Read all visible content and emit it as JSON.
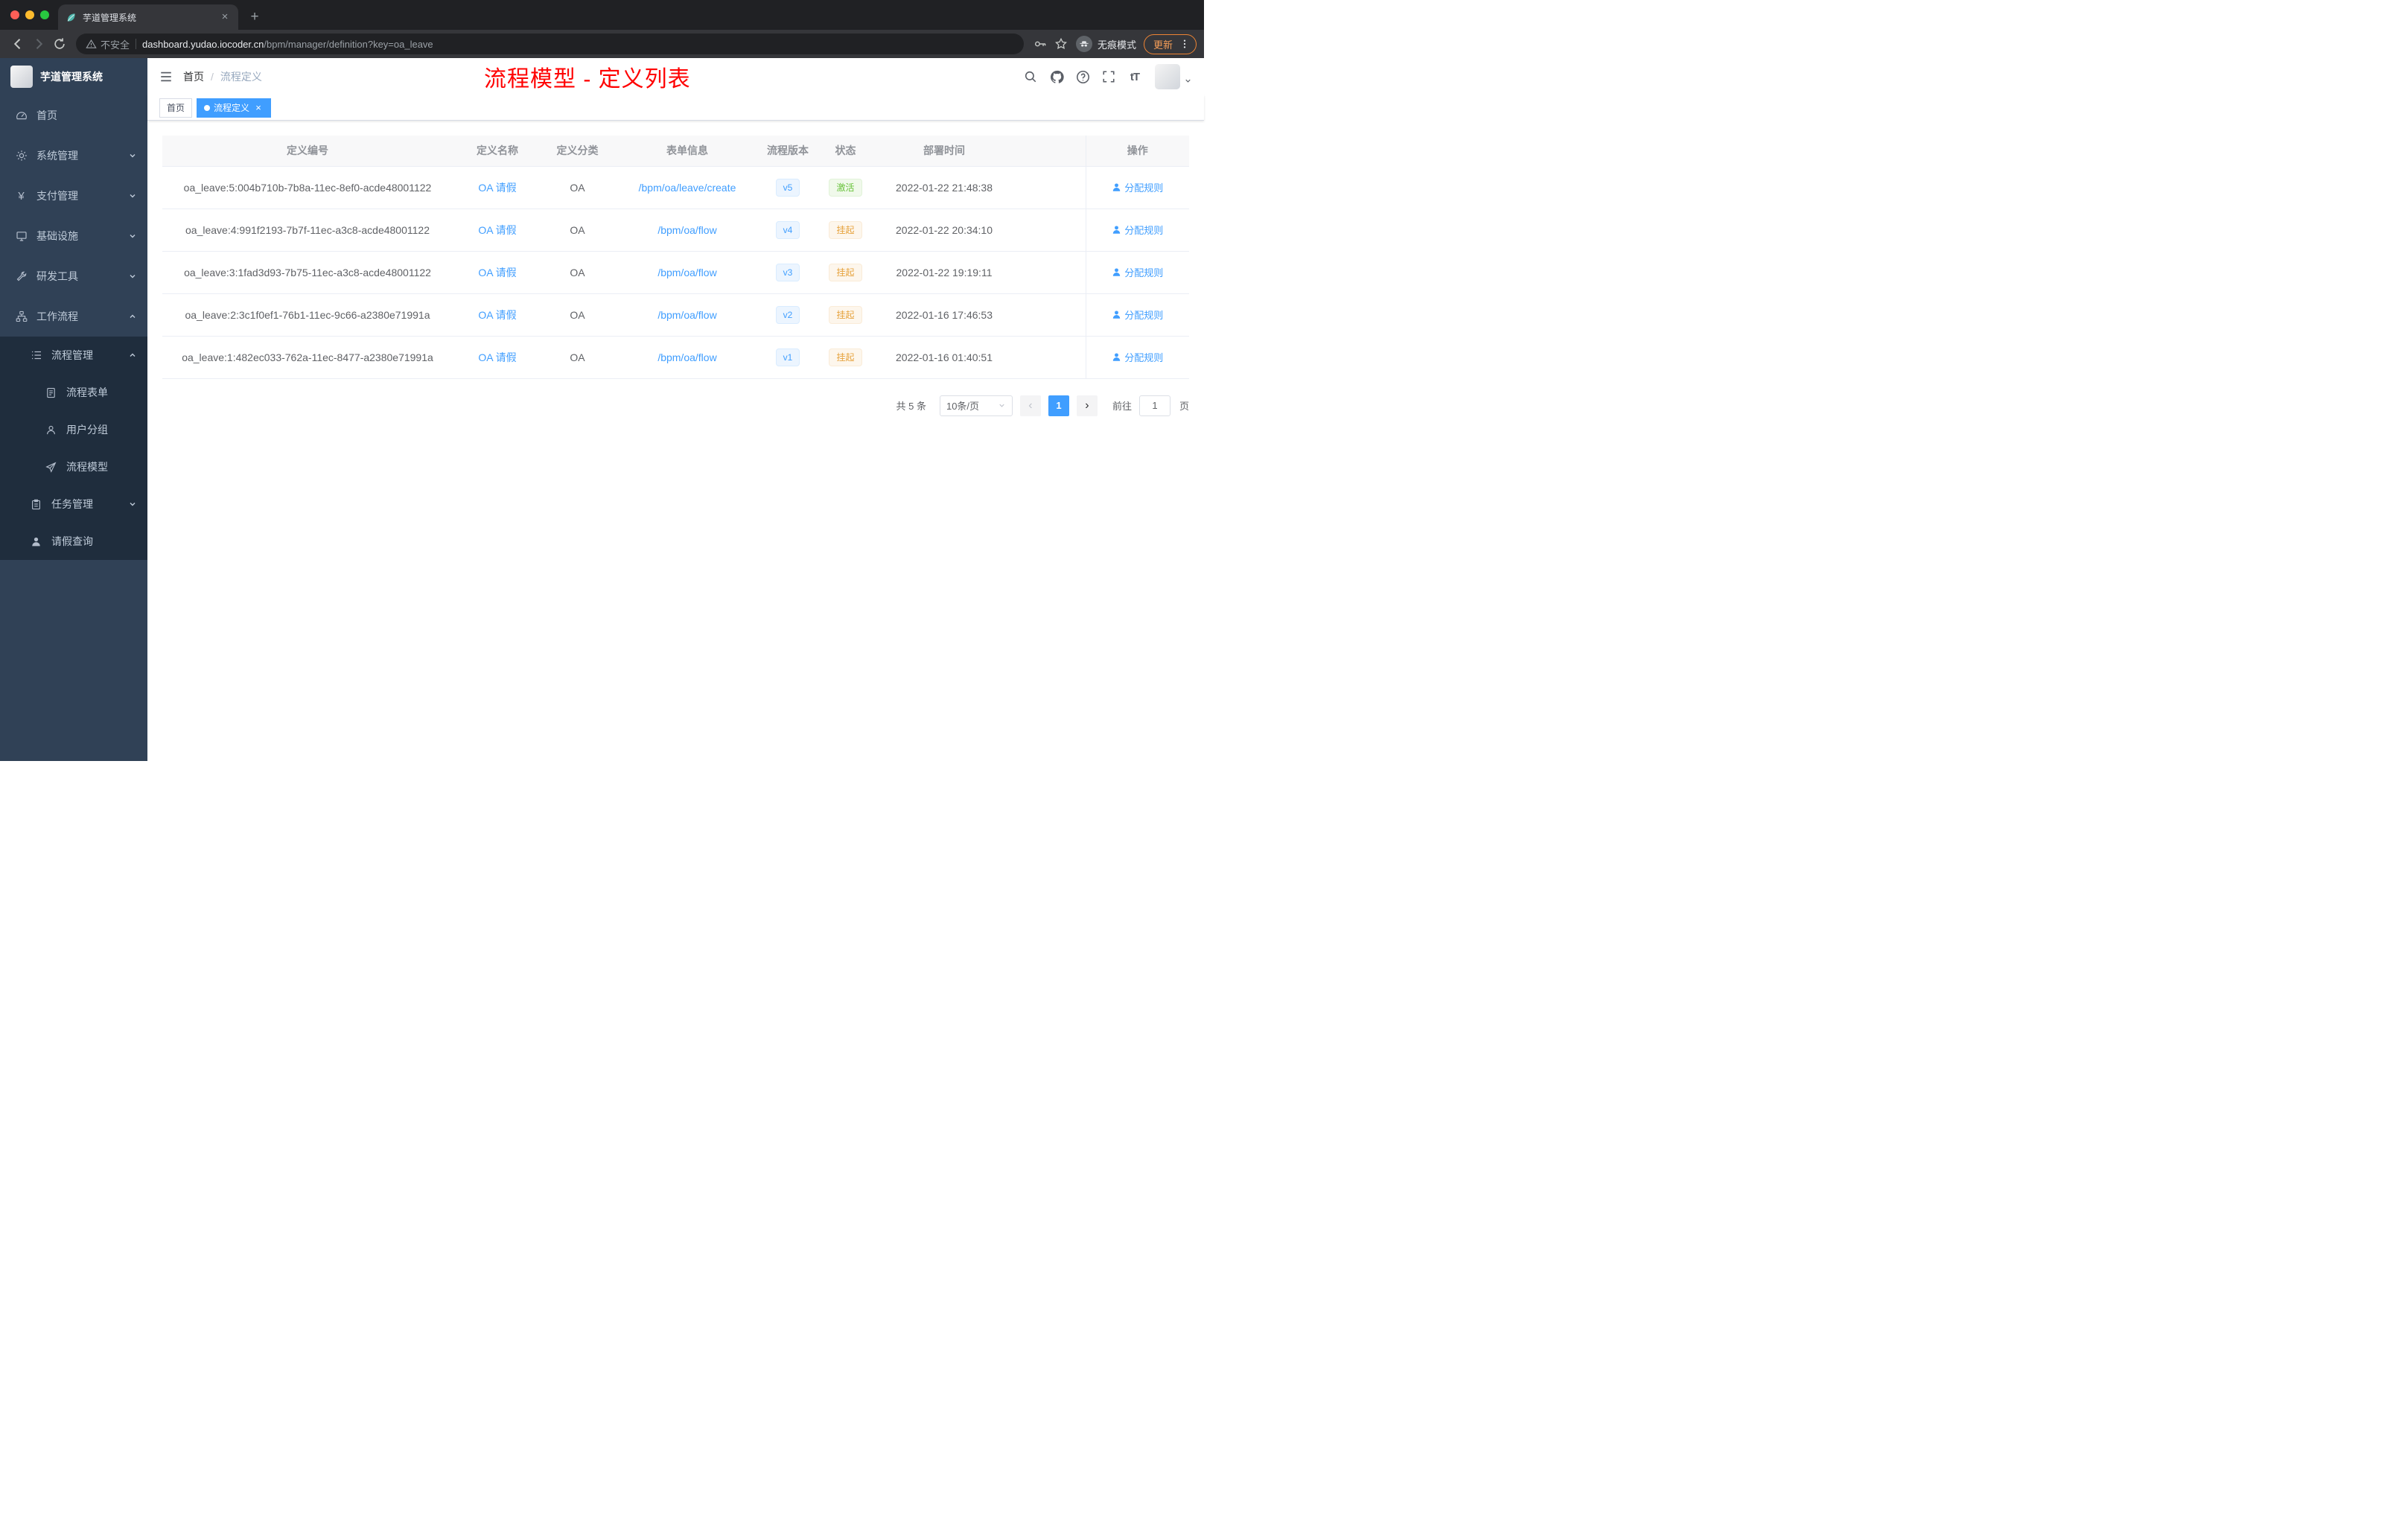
{
  "colors": {
    "accent": "#409eff",
    "success": "#67c23a",
    "warning": "#e6a23c",
    "annotation_red": "#ff0000",
    "sidebar_bg": "#304156",
    "submenu_bg": "#1f2d3d"
  },
  "browser": {
    "tab_title": "芋道管理系统",
    "security_label": "不安全",
    "url_host": "dashboard.yudao.iocoder.cn",
    "url_path": "/bpm/manager/definition?key=oa_leave",
    "incognito_label": "无痕模式",
    "update_label": "更新"
  },
  "sidebar": {
    "logo_title": "芋道管理系统",
    "menu": [
      {
        "label": "首页"
      },
      {
        "label": "系统管理"
      },
      {
        "label": "支付管理"
      },
      {
        "label": "基础设施"
      },
      {
        "label": "研发工具"
      },
      {
        "label": "工作流程"
      }
    ],
    "submenu": [
      {
        "label": "流程管理"
      },
      {
        "label": "流程表单"
      },
      {
        "label": "用户分组"
      },
      {
        "label": "流程模型"
      },
      {
        "label": "任务管理"
      },
      {
        "label": "请假查询"
      }
    ]
  },
  "navbar": {
    "breadcrumb": [
      "首页",
      "流程定义"
    ],
    "annotation": "流程模型 - 定义列表"
  },
  "tags": [
    {
      "label": "首页"
    },
    {
      "label": "流程定义"
    }
  ],
  "table": {
    "headers": [
      "定义编号",
      "定义名称",
      "定义分类",
      "表单信息",
      "流程版本",
      "状态",
      "部署时间",
      "操作"
    ],
    "rows": [
      {
        "id": "oa_leave:5:004b710b-7b8a-11ec-8ef0-acde48001122",
        "name": "OA 请假",
        "category": "OA",
        "form": "/bpm/oa/leave/create",
        "version": "v5",
        "status": "激活",
        "time": "2022-01-22 21:48:38",
        "action": "分配规则"
      },
      {
        "id": "oa_leave:4:991f2193-7b7f-11ec-a3c8-acde48001122",
        "name": "OA 请假",
        "category": "OA",
        "form": "/bpm/oa/flow",
        "version": "v4",
        "status": "挂起",
        "time": "2022-01-22 20:34:10",
        "action": "分配规则"
      },
      {
        "id": "oa_leave:3:1fad3d93-7b75-11ec-a3c8-acde48001122",
        "name": "OA 请假",
        "category": "OA",
        "form": "/bpm/oa/flow",
        "version": "v3",
        "status": "挂起",
        "time": "2022-01-22 19:19:11",
        "action": "分配规则"
      },
      {
        "id": "oa_leave:2:3c1f0ef1-76b1-11ec-9c66-a2380e71991a",
        "name": "OA 请假",
        "category": "OA",
        "form": "/bpm/oa/flow",
        "version": "v2",
        "status": "挂起",
        "time": "2022-01-16 17:46:53",
        "action": "分配规则"
      },
      {
        "id": "oa_leave:1:482ec033-762a-11ec-8477-a2380e71991a",
        "name": "OA 请假",
        "category": "OA",
        "form": "/bpm/oa/flow",
        "version": "v1",
        "status": "挂起",
        "time": "2022-01-16 01:40:51",
        "action": "分配规则"
      }
    ]
  },
  "pagination": {
    "total": "共 5 条",
    "page_size": "10条/页",
    "current_page": "1",
    "goto_label": "前往",
    "goto_value": "1",
    "unit_label": "页"
  }
}
